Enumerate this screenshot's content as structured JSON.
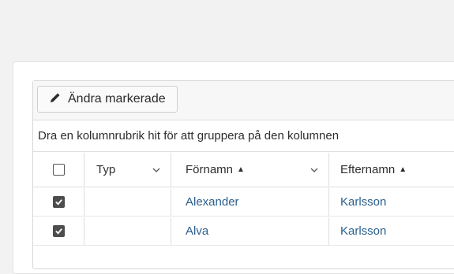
{
  "toolbar": {
    "edit_button_label": "Ändra markerade",
    "edit_button_icon": "pencil-icon"
  },
  "group_panel": {
    "hint": "Dra en kolumnrubrik hit för att gruppera på den kolumnen"
  },
  "columns": [
    {
      "label": "",
      "type": "checkbox",
      "checked": false
    },
    {
      "label": "Typ",
      "sort": null,
      "menu_icon": "chevron-down-icon"
    },
    {
      "label": "Förnamn",
      "sort": "▲",
      "menu_icon": "chevron-down-icon"
    },
    {
      "label": "Efternamn",
      "sort": "▲"
    }
  ],
  "rows": [
    {
      "selected": true,
      "typ": "",
      "fornamn": "Alexander",
      "efternamn": "Karlsson"
    },
    {
      "selected": true,
      "typ": "",
      "fornamn": "Alva",
      "efternamn": "Karlsson"
    }
  ],
  "colors": {
    "link": "#2a5f8d",
    "page_background": "#f2f2f2",
    "checkbox_checked": "#4d4d4d"
  }
}
